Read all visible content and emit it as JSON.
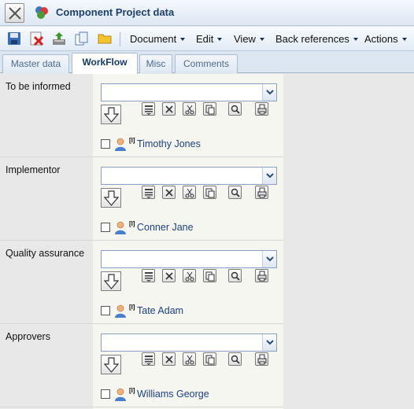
{
  "window": {
    "title": "Component Project data",
    "close_icon": "close-x-icon",
    "app_icon": "component-cubes-icon"
  },
  "toolbar": {
    "icons": [
      "save-icon",
      "delete-icon",
      "upload-icon",
      "copy-icon",
      "folder-icon"
    ],
    "menus": [
      {
        "label": "Document"
      },
      {
        "label": "Edit"
      },
      {
        "label": "View"
      },
      {
        "label": "Back references"
      },
      {
        "label": "Actions"
      }
    ]
  },
  "tabs": [
    {
      "label": "Master data",
      "active": false
    },
    {
      "label": "WorkFlow",
      "active": true
    },
    {
      "label": "Misc",
      "active": false
    },
    {
      "label": "Comments",
      "active": false
    }
  ],
  "sections": [
    {
      "label": "To be informed",
      "combo_value": "",
      "member": {
        "marker": "[I]",
        "name": "Timothy Jones",
        "checked": false
      }
    },
    {
      "label": "Implementor",
      "combo_value": "",
      "member": {
        "marker": "[I]",
        "name": "Conner Jane",
        "checked": false
      }
    },
    {
      "label": "Quality assurance",
      "combo_value": "",
      "member": {
        "marker": "[I]",
        "name": "Tate Adam",
        "checked": false
      }
    },
    {
      "label": "Approvers",
      "combo_value": "",
      "member": {
        "marker": "[I]",
        "name": "Williams George",
        "checked": false
      }
    }
  ],
  "section_tools": [
    "move-down-icon",
    "list-icon",
    "remove-icon",
    "cut-icon",
    "paste-icon",
    "search-icon",
    "print-icon"
  ],
  "colors": {
    "title_text": "#1c3f6e",
    "link_blue": "#1b3f86",
    "tab_active_text": "#15396a",
    "value_bg": "#f6f6f1",
    "label_bg": "#e8e8e8"
  }
}
